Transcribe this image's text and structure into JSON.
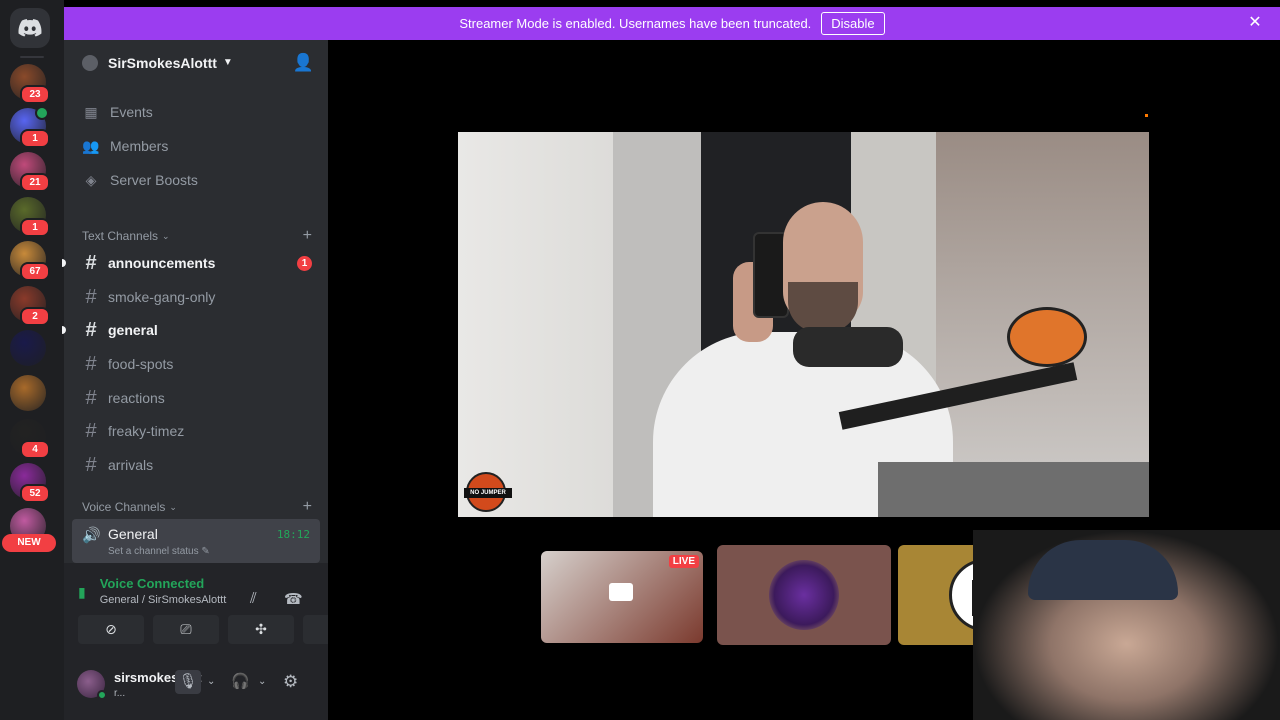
{
  "banner": {
    "message": "Streamer Mode is enabled. Usernames have been truncated.",
    "disable_label": "Disable",
    "close_glyph": "✕"
  },
  "rail": {
    "servers": [
      {
        "badge": "23",
        "color": "#8a4a2a"
      },
      {
        "badge": "1",
        "color": "#5865f2",
        "voice": true
      },
      {
        "badge": "21",
        "color": "#c04a7a"
      },
      {
        "badge": "1",
        "color": "#5a6a2a"
      },
      {
        "badge": "67",
        "color": "#c88a3a"
      },
      {
        "badge": "2",
        "color": "#8a3a2a"
      },
      {
        "badge": "",
        "color": "#1a1a4a"
      },
      {
        "badge": "",
        "color": "#a86a2a"
      },
      {
        "badge": "4",
        "color": "#222222"
      },
      {
        "badge": "52",
        "color": "#8a2a9a"
      },
      {
        "badge": "",
        "color": "#c05aa0"
      }
    ],
    "new_label": "NEW"
  },
  "server": {
    "name": "SirSmokesAlottt",
    "nav": [
      "Events",
      "Members",
      "Server Boosts"
    ],
    "text_category": "Text Channels",
    "voice_category": "Voice Channels",
    "channels": [
      {
        "name": "announcements",
        "unread": true,
        "badge": "1"
      },
      {
        "name": "smoke-gang-only",
        "unread": false
      },
      {
        "name": "general",
        "unread": true
      },
      {
        "name": "food-spots",
        "unread": false
      },
      {
        "name": "reactions",
        "unread": false
      },
      {
        "name": "freaky-timez",
        "unread": false
      },
      {
        "name": "arrivals",
        "unread": false
      }
    ],
    "voice_channel": {
      "name": "General",
      "time": "18:12",
      "status": "Set a channel status"
    }
  },
  "voice_panel": {
    "status": "Voice Connected",
    "location": "General / SirSmokesAlottt"
  },
  "user": {
    "name": "sirsmokesalot",
    "status": "r..."
  },
  "stream": {
    "live_label": "LIVE",
    "watermark": "NO JUMPER"
  },
  "colors": {
    "accent": "#9b3df0",
    "online": "#23a55a",
    "danger": "#f23f43"
  }
}
